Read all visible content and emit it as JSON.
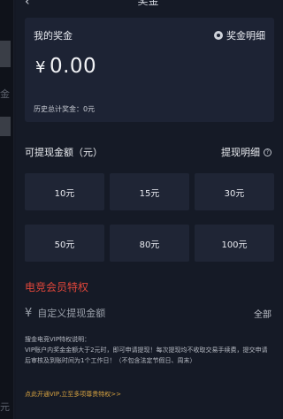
{
  "header": {
    "back_icon": "chevron-left-icon",
    "title": "奖金"
  },
  "bonus_card": {
    "label": "我的奖金",
    "detail_label": "奖金明细",
    "currency": "¥",
    "amount": "0.00",
    "history_label": "历史总计奖金：",
    "history_value": "0元"
  },
  "withdraw": {
    "title": "可提现金额（元）",
    "detail_label": "提现明细",
    "options": [
      "10元",
      "15元",
      "30元",
      "50元",
      "80元",
      "100元"
    ]
  },
  "vip": {
    "title": "电竞会员特权",
    "currency": "¥",
    "custom_placeholder": "自定义提现金额",
    "all_label": "全部",
    "note_title": "搜金电竞VIP特权说明：",
    "note_body": "VIP账户内奖金金额大于2元时，即可申请提现！每次提现均不收取交易手续费，提交申请后审核及到账时间为1个工作日！（不包含法定节假日、周末）",
    "link": "点此开通VIP,立至多项尊贵特权>>"
  },
  "left_strip": {
    "chars": [
      "金",
      "元"
    ]
  },
  "colors": {
    "background": "#151a26",
    "card": "#1d2334",
    "accent_red": "#e0463a",
    "link_gold": "#d9a441"
  }
}
